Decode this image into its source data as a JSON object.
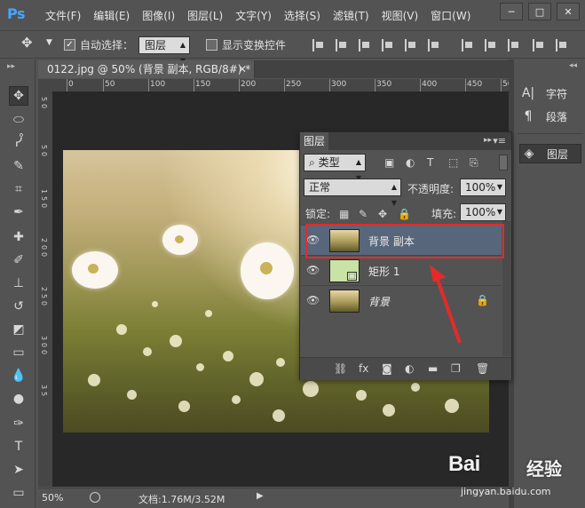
{
  "app": {
    "logo": "Ps",
    "menus": [
      "文件(F)",
      "编辑(E)",
      "图像(I)",
      "图层(L)",
      "文字(Y)",
      "选择(S)",
      "滤镜(T)",
      "视图(V)",
      "窗口(W)"
    ],
    "window_controls": [
      "─",
      "□",
      "✕"
    ]
  },
  "options_bar": {
    "auto_select_label": "自动选择：",
    "auto_select_value": "图层",
    "auto_select_checked": true,
    "show_transform_label": "显示变换控件",
    "show_transform_checked": false
  },
  "document": {
    "tab_title": "0122.jpg @ 50% (背景 副本, RGB/8#) *",
    "ruler_h_labels": [
      "0",
      "50",
      "100",
      "150",
      "200",
      "250",
      "300",
      "350",
      "400",
      "450",
      "500"
    ],
    "ruler_v_labels": [
      "5",
      "0",
      "5",
      "0",
      "1",
      "5",
      "0",
      "2",
      "0",
      "0",
      "2",
      "5",
      "0",
      "3",
      "0",
      "0",
      "3",
      "5"
    ]
  },
  "status": {
    "zoom": "50%",
    "doc_size": "文档:1.76M/3.52M"
  },
  "right_dock": {
    "items": [
      {
        "label": "字符",
        "icon": "character-icon"
      },
      {
        "label": "段落",
        "icon": "paragraph-icon"
      },
      {
        "label": "图层",
        "icon": "layers-icon"
      }
    ]
  },
  "layers_panel": {
    "tab_label": "图层",
    "filter_label": "类型",
    "blend_mode": "正常",
    "opacity_label": "不透明度:",
    "opacity_value": "100%",
    "lock_label": "锁定:",
    "fill_label": "填充:",
    "fill_value": "100%",
    "layers": [
      {
        "name": "背景 副本",
        "selected": true,
        "thumb": "photo"
      },
      {
        "name": "矩形 1",
        "selected": false,
        "thumb": "shape"
      },
      {
        "name": "背景",
        "selected": false,
        "thumb": "photo",
        "locked": true
      }
    ],
    "bottom_icons": [
      "link-icon",
      "fx-icon",
      "mask-icon",
      "adjustment-icon",
      "group-icon",
      "new-layer-icon",
      "delete-icon"
    ]
  },
  "colors": {
    "ui_gray": "#535353",
    "highlight_red": "#e32b2b",
    "selected_row": "#57667a",
    "ps_blue": "#4aa3ff"
  },
  "watermark": {
    "brand": "Bai",
    "brand_cn": "经验",
    "url": "jingyan.baidu.com"
  }
}
